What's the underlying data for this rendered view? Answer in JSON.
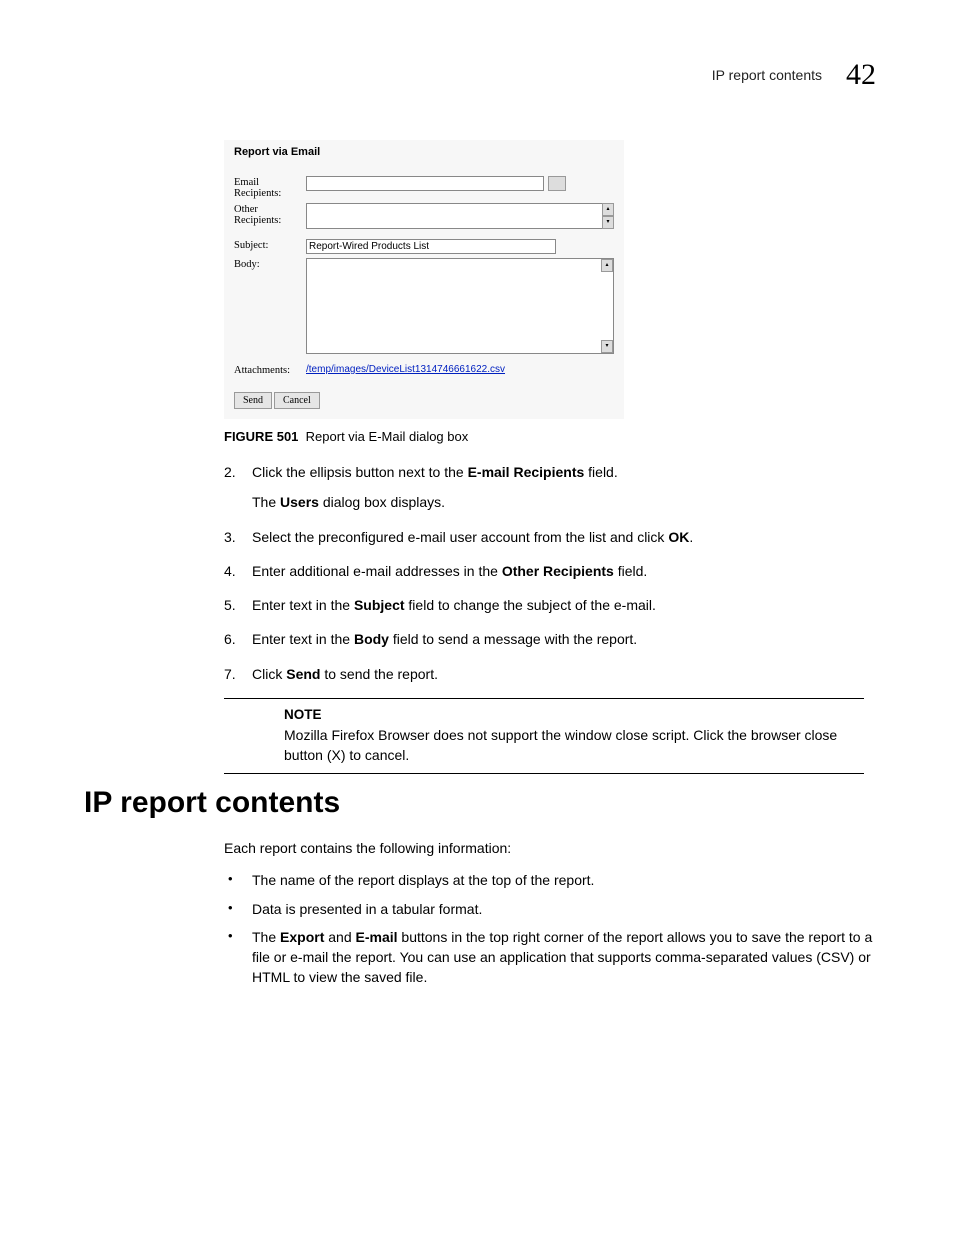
{
  "header": {
    "title": "IP report contents",
    "chapter_number": "42"
  },
  "dialog": {
    "title": "Report via Email",
    "labels": {
      "email_recipients": "Email Recipients:",
      "other_recipients": "Other Recipients:",
      "subject": "Subject:",
      "body": "Body:",
      "attachments": "Attachments:"
    },
    "subject_value": "Report-Wired Products List",
    "attachment_link": "/temp/images/DeviceList1314746661622.csv",
    "buttons": {
      "send": "Send",
      "cancel": "Cancel"
    }
  },
  "figure": {
    "label": "FIGURE 501",
    "caption": "Report via E-Mail dialog box"
  },
  "steps": [
    {
      "num": "2.",
      "parts": [
        "Click the ellipsis button next to the ",
        "E-mail Recipients",
        " field."
      ],
      "sub_parts": [
        "The ",
        "Users",
        " dialog box displays."
      ]
    },
    {
      "num": "3.",
      "parts": [
        "Select the preconfigured e-mail user account from the list and click ",
        "OK",
        "."
      ]
    },
    {
      "num": "4.",
      "parts": [
        "Enter additional e-mail addresses in the ",
        "Other Recipients",
        " field."
      ]
    },
    {
      "num": "5.",
      "parts": [
        "Enter text in the ",
        "Subject",
        " field to change the subject of the e-mail."
      ]
    },
    {
      "num": "6.",
      "parts": [
        "Enter text in the ",
        "Body",
        " field to send a message with the report."
      ]
    },
    {
      "num": "7.",
      "parts": [
        "Click ",
        "Send",
        " to send the report."
      ]
    }
  ],
  "note": {
    "label": "NOTE",
    "text": "Mozilla Firefox Browser does not support the window close script. Click the browser close button (X) to cancel."
  },
  "section": {
    "heading": "IP report contents",
    "intro": "Each report contains the following information:",
    "bullets": [
      {
        "parts": [
          "The name of the report displays at the top of the report."
        ]
      },
      {
        "parts": [
          "Data is presented in a tabular format."
        ]
      },
      {
        "parts": [
          "The ",
          "Export",
          " and ",
          "E-mail",
          " buttons in the top right corner of the report allows you to save the report to a file or e-mail the report. You can use an application that supports comma-separated values (CSV) or HTML to view the saved file."
        ]
      }
    ]
  }
}
